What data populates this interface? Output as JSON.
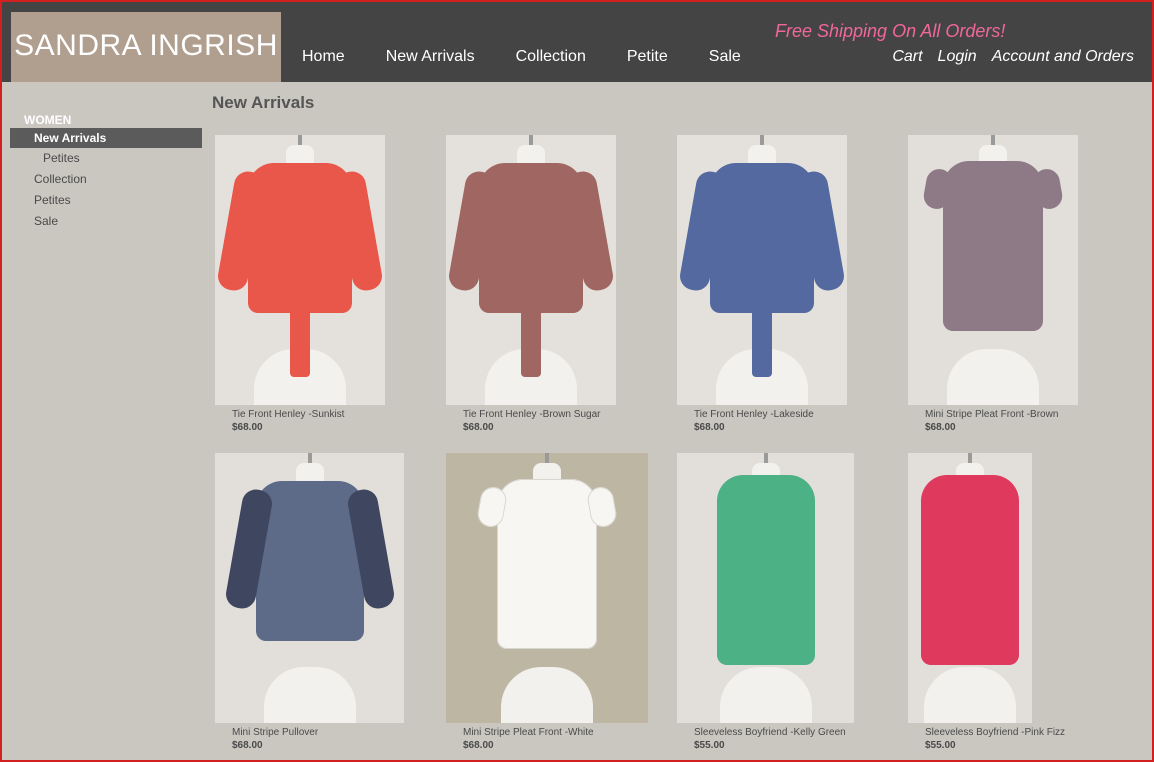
{
  "brand": {
    "logo_text": "SANDRA INGRISH"
  },
  "header": {
    "promo": "Free Shipping On All Orders!",
    "nav": [
      "Home",
      "New Arrivals",
      "Collection",
      "Petite",
      "Sale"
    ],
    "user_nav": [
      "Cart",
      "Login",
      "Account and Orders"
    ]
  },
  "sidebar": {
    "section": "WOMEN",
    "items": [
      {
        "label": "New Arrivals",
        "active": true
      },
      {
        "label": "Petites",
        "sub": true
      },
      {
        "label": "Collection"
      },
      {
        "label": "Petites"
      },
      {
        "label": "Sale"
      }
    ]
  },
  "main": {
    "title": "New Arrivals",
    "products": [
      {
        "name": "Tie Front Henley -Sunkist",
        "price": "$68.00",
        "color": "#e8574a",
        "bg": "#e4e1dc",
        "style": "henley"
      },
      {
        "name": "Tie Front Henley -Brown Sugar",
        "price": "$68.00",
        "color": "#a06661",
        "bg": "#e4e1dc",
        "style": "henley"
      },
      {
        "name": "Tie Front Henley -Lakeside",
        "price": "$68.00",
        "color": "#5469a0",
        "bg": "#e4e1dc",
        "style": "henley"
      },
      {
        "name": "Mini Stripe Pleat Front -Brown",
        "price": "$68.00",
        "color": "#8e7a86",
        "bg": "#e2dfdb",
        "style": "pleat"
      },
      {
        "name": "Mini Stripe Pullover",
        "price": "$68.00",
        "color": "#5d6a88",
        "bg": "#e2dfdb",
        "style": "pullover"
      },
      {
        "name": "Mini Stripe Pleat Front -White",
        "price": "$68.00",
        "color": "#f7f6f3",
        "bg": "#bdb6a3",
        "style": "pleat"
      },
      {
        "name": "Sleeveless Boyfriend -Kelly Green",
        "price": "$55.00",
        "color": "#4cb184",
        "bg": "#e2dfdb",
        "style": "sleeveless"
      },
      {
        "name": "Sleeveless Boyfriend -Pink Fizz",
        "price": "$55.00",
        "color": "#e0395e",
        "bg": "#e2dfdb",
        "style": "sleeveless"
      }
    ]
  },
  "colors": {
    "header_bg": "#444444",
    "logo_bg": "#b09e8e",
    "promo": "#f0679a",
    "page_bg": "#c9c7c0",
    "active_nav": "#5b5b5b"
  }
}
